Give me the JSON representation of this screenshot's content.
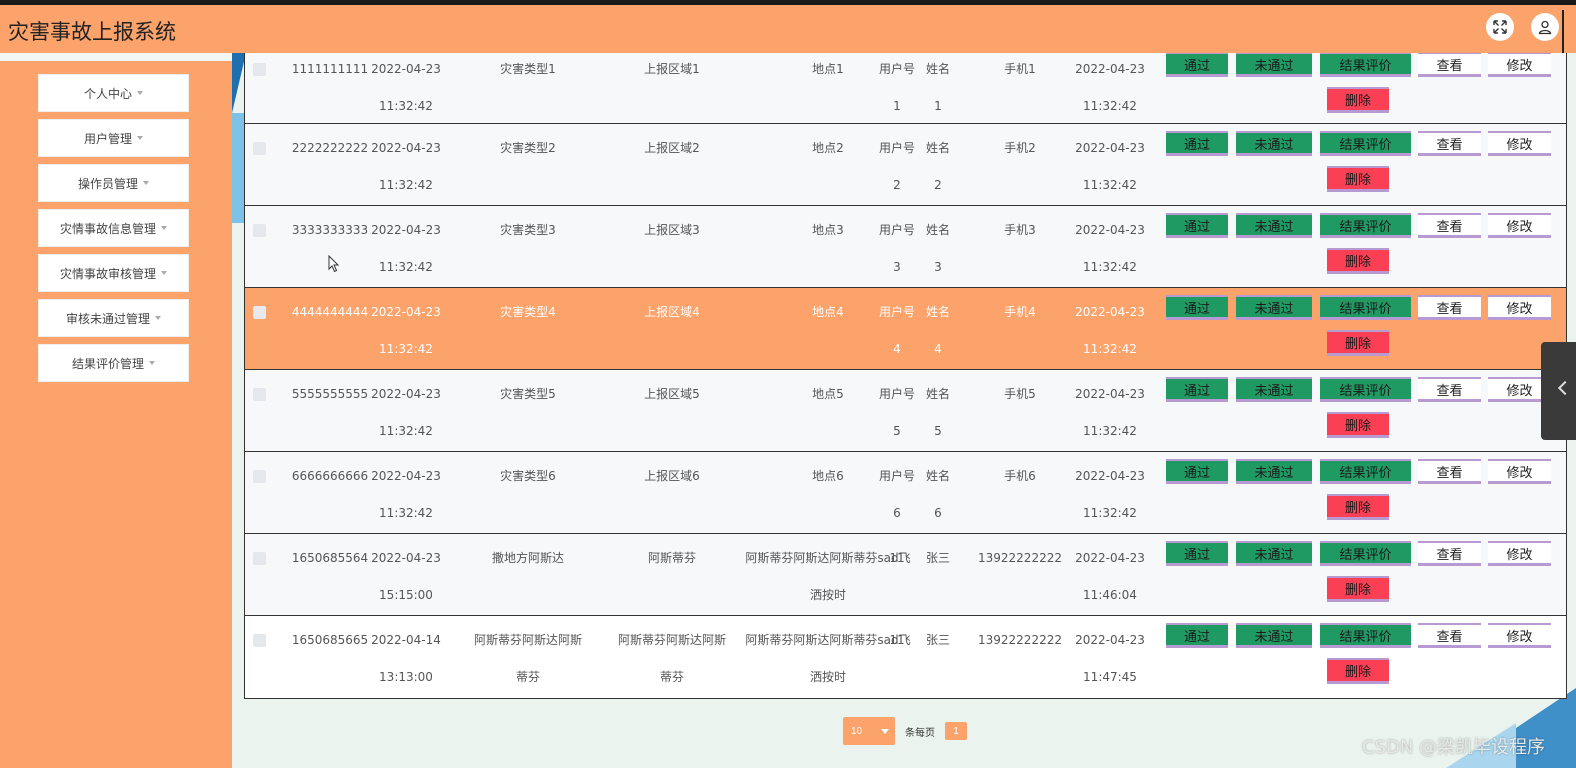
{
  "header": {
    "title": "灾害事故上报系统"
  },
  "sidebar": {
    "items": [
      {
        "label": "个人中心"
      },
      {
        "label": "用户管理"
      },
      {
        "label": "操作员管理"
      },
      {
        "label": "灾情事故信息管理"
      },
      {
        "label": "灾情事故审核管理"
      },
      {
        "label": "审核未通过管理"
      },
      {
        "label": "结果评价管理"
      }
    ]
  },
  "table": {
    "rows": [
      {
        "id": "1111111111",
        "date": "2022-04-23",
        "time": "11:32:42",
        "type_l1": "灾害类型1",
        "type_l2": "",
        "area_l1": "上报区域1",
        "area_l2": "",
        "place_l1": "地点1",
        "place_l2": "",
        "uid_l1": "用户号",
        "uid_l2": "1",
        "name_l1": "姓名",
        "name_l2": "1",
        "phone": "手机1",
        "rdate": "2022-04-23",
        "rtime": "11:32:42"
      },
      {
        "id": "2222222222",
        "date": "2022-04-23",
        "time": "11:32:42",
        "type_l1": "灾害类型2",
        "type_l2": "",
        "area_l1": "上报区域2",
        "area_l2": "",
        "place_l1": "地点2",
        "place_l2": "",
        "uid_l1": "用户号",
        "uid_l2": "2",
        "name_l1": "姓名",
        "name_l2": "2",
        "phone": "手机2",
        "rdate": "2022-04-23",
        "rtime": "11:32:42"
      },
      {
        "id": "3333333333",
        "date": "2022-04-23",
        "time": "11:32:42",
        "type_l1": "灾害类型3",
        "type_l2": "",
        "area_l1": "上报区域3",
        "area_l2": "",
        "place_l1": "地点3",
        "place_l2": "",
        "uid_l1": "用户号",
        "uid_l2": "3",
        "name_l1": "姓名",
        "name_l2": "3",
        "phone": "手机3",
        "rdate": "2022-04-23",
        "rtime": "11:32:42"
      },
      {
        "id": "4444444444",
        "date": "2022-04-23",
        "time": "11:32:42",
        "type_l1": "灾害类型4",
        "type_l2": "",
        "area_l1": "上报区域4",
        "area_l2": "",
        "place_l1": "地点4",
        "place_l2": "",
        "uid_l1": "用户号",
        "uid_l2": "4",
        "name_l1": "姓名",
        "name_l2": "4",
        "phone": "手机4",
        "rdate": "2022-04-23",
        "rtime": "11:32:42"
      },
      {
        "id": "5555555555",
        "date": "2022-04-23",
        "time": "11:32:42",
        "type_l1": "灾害类型5",
        "type_l2": "",
        "area_l1": "上报区域5",
        "area_l2": "",
        "place_l1": "地点5",
        "place_l2": "",
        "uid_l1": "用户号",
        "uid_l2": "5",
        "name_l1": "姓名",
        "name_l2": "5",
        "phone": "手机5",
        "rdate": "2022-04-23",
        "rtime": "11:32:42"
      },
      {
        "id": "6666666666",
        "date": "2022-04-23",
        "time": "11:32:42",
        "type_l1": "灾害类型6",
        "type_l2": "",
        "area_l1": "上报区域6",
        "area_l2": "",
        "place_l1": "地点6",
        "place_l2": "",
        "uid_l1": "用户号",
        "uid_l2": "6",
        "name_l1": "姓名",
        "name_l2": "6",
        "phone": "手机6",
        "rdate": "2022-04-23",
        "rtime": "11:32:42"
      },
      {
        "id": "1650685564",
        "date": "2022-04-23",
        "time": "15:15:00",
        "type_l1": "撒地方阿斯达",
        "type_l2": "",
        "area_l1": "阿斯蒂芬",
        "area_l2": "",
        "place_l1": "阿斯蒂芬阿斯达阿斯蒂芬sad飞",
        "place_l2": "洒按时",
        "uid_l1": "11",
        "uid_l2": "",
        "name_l1": "张三",
        "name_l2": "",
        "phone": "13922222222",
        "rdate": "2022-04-23",
        "rtime": "11:46:04"
      },
      {
        "id": "1650685665",
        "date": "2022-04-14",
        "time": "13:13:00",
        "type_l1": "阿斯蒂芬阿斯达阿斯",
        "type_l2": "蒂芬",
        "area_l1": "阿斯蒂芬阿斯达阿斯",
        "area_l2": "蒂芬",
        "place_l1": "阿斯蒂芬阿斯达阿斯蒂芬sad飞",
        "place_l2": "洒按时",
        "uid_l1": "11",
        "uid_l2": "",
        "name_l1": "张三",
        "name_l2": "",
        "phone": "13922222222",
        "rdate": "2022-04-23",
        "rtime": "11:47:45"
      }
    ],
    "actions": {
      "pass": "通过",
      "fail": "未通过",
      "evaluate": "结果评价",
      "view": "查看",
      "edit": "修改",
      "delete": "删除"
    }
  },
  "pagination": {
    "page_size": "10",
    "per_page_label": "条每页",
    "current_page": "1"
  },
  "watermark": "CSDN @梁凯毕设程序",
  "colors": {
    "accent": "#fca26b",
    "green": "#1f9a63",
    "red": "#fb3f54",
    "border": "#b79ad2"
  }
}
